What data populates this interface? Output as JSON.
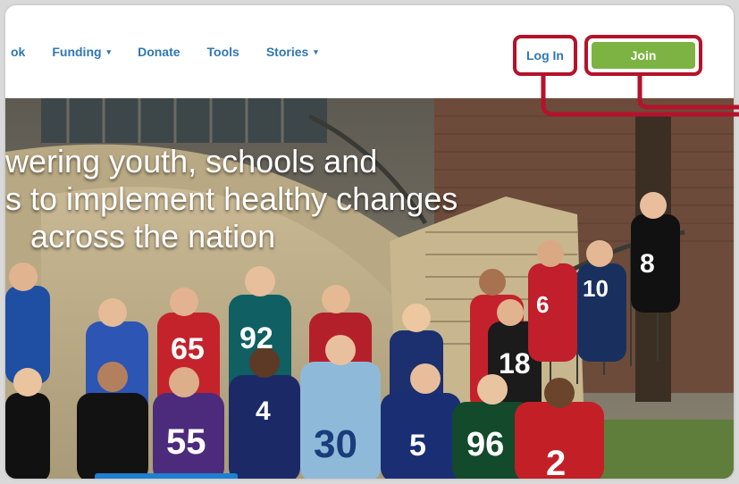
{
  "nav": {
    "items": [
      {
        "label": "ok",
        "caret": false
      },
      {
        "label": "Funding",
        "caret": true
      },
      {
        "label": "Donate",
        "caret": false
      },
      {
        "label": "Tools",
        "caret": false
      },
      {
        "label": "Stories",
        "caret": true
      }
    ],
    "caret_glyph": "▾"
  },
  "auth": {
    "login_label": "Log In",
    "join_label": "Join"
  },
  "hero": {
    "lines": [
      "wering youth, schools and",
      "s to implement healthy changes",
      "across the nation"
    ],
    "jersey_numbers": [
      "65",
      "92",
      "30",
      "4",
      "55",
      "96",
      "2",
      "5",
      "8",
      "6",
      "10",
      "18"
    ]
  },
  "colors": {
    "nav_text": "#2f77b5",
    "join_bg": "#7cb342",
    "highlight": "#b3132b"
  }
}
